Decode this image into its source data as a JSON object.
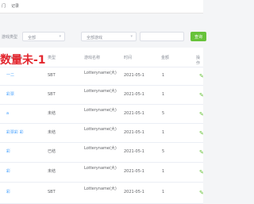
{
  "breadcrumb": [
    "门",
    "记录"
  ],
  "filters": [
    {
      "label": "游戏类型",
      "value": "全部"
    },
    {
      "label": "",
      "value": "全部游戏"
    }
  ],
  "search_label": "查询",
  "columns": [
    "游戏名称",
    "类型",
    "游戏名称",
    "时间",
    "金额",
    "操作"
  ],
  "rows": [
    {
      "name": "一二",
      "type": "SBT",
      "game": "Lotteryname(大)",
      "time": "2021-05-1",
      "amount": "1"
    },
    {
      "name": "彩票",
      "type": "SBT",
      "game": "Lotteryname(大)",
      "time": "2021-05-1",
      "amount": "1"
    },
    {
      "name": "a",
      "type": "未结",
      "game": "Lotteryname(大)",
      "time": "2021-05-1",
      "amount": "5"
    },
    {
      "name": "彩票彩 彩",
      "type": "未结",
      "game": "Lotteryname(大)",
      "time": "2021-05-1",
      "amount": "1"
    },
    {
      "name": "彩",
      "type": "已结",
      "game": "Lotteryname(大)",
      "time": "2021-05-1",
      "amount": "5"
    },
    {
      "name": "彩",
      "type": "未结",
      "game": "Lotteryname(大)",
      "time": "2021-05-1",
      "amount": "1"
    },
    {
      "name": "彩",
      "type": "SBT",
      "game": "Lotteryname(大)",
      "time": "2021-05-1",
      "amount": "1"
    }
  ],
  "overlay_text": "数量未-1",
  "colors": {
    "accent": "#67c23a",
    "link": "#409eff",
    "overlay": "#e3262e"
  },
  "op_icon": "edit-icon"
}
